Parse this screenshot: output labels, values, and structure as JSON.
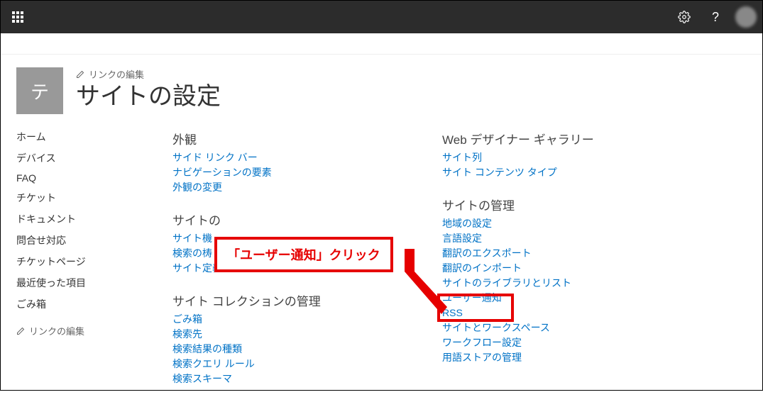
{
  "header": {
    "tile_char": "テ",
    "edit_links_label": "リンクの編集",
    "page_title": "サイトの設定"
  },
  "leftnav": {
    "items": [
      "ホーム",
      "デバイス",
      "FAQ",
      "チケット",
      "ドキュメント",
      "問合せ対応",
      "チケットページ",
      "最近使った項目",
      "ごみ箱"
    ],
    "edit_links_label": "リンクの編集"
  },
  "sections": {
    "col1": [
      {
        "title": "外観",
        "links": [
          "サイド リンク バー",
          "ナビゲーションの要素",
          "外観の変更"
        ]
      },
      {
        "title": "サイトの",
        "links": [
          "サイト機",
          "検索の梼",
          "サイト定義へのリセット"
        ]
      },
      {
        "title": "サイト コレクションの管理",
        "links": [
          "ごみ箱",
          "検索先",
          "検索結果の種類",
          "検索クエリ ルール",
          "検索スキーマ"
        ]
      }
    ],
    "col2": [
      {
        "title": "Web デザイナー ギャラリー",
        "links": [
          "サイト列",
          "サイト コンテンツ タイプ"
        ]
      },
      {
        "title": "サイトの管理",
        "links": [
          "地域の設定",
          "言語設定",
          "翻訳のエクスポート",
          "翻訳のインポート",
          "サイトのライブラリとリスト",
          "ユーザー通知",
          "RSS",
          "サイトとワークスペース",
          "ワークフロー設定",
          "用語ストアの管理"
        ]
      }
    ]
  },
  "callout": {
    "text": "「ユーザー通知」クリック"
  }
}
